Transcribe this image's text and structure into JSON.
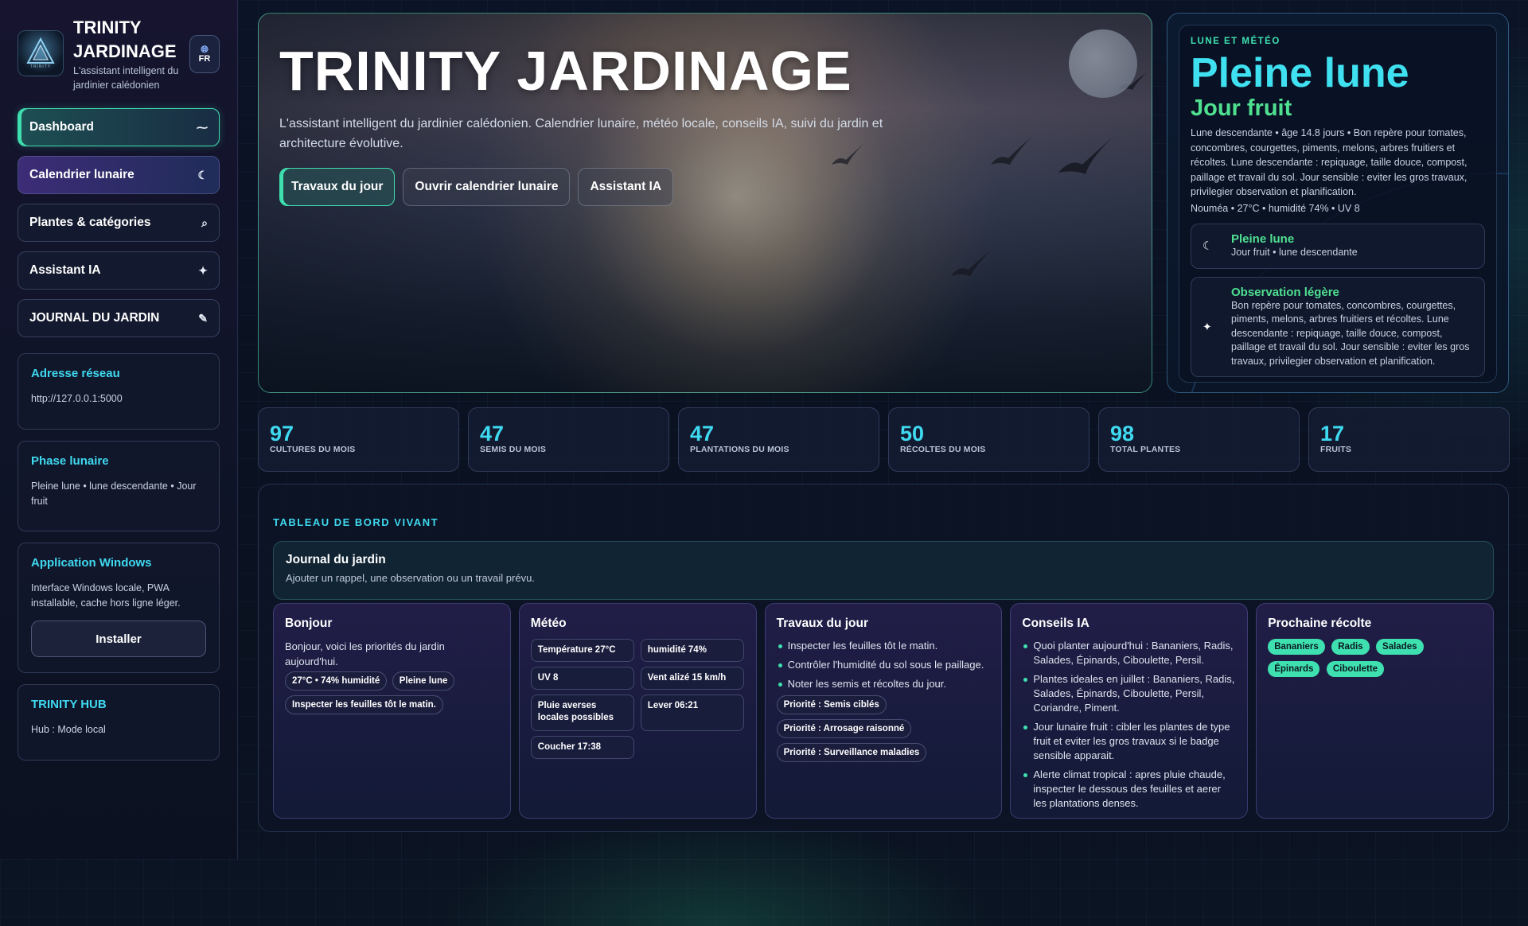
{
  "brand": {
    "title_line1": "TRINITY",
    "title_line2": "JARDINAGE",
    "subtitle": "L'assistant intelligent du jardinier calédonien",
    "logo_text": "TRINITY",
    "lang": "FR"
  },
  "nav": [
    {
      "label": "Dashboard",
      "icon": "pulse-icon"
    },
    {
      "label": "Calendrier lunaire",
      "icon": "moon-icon"
    },
    {
      "label": "Plantes & catégories",
      "icon": "search-icon"
    },
    {
      "label": "Assistant IA",
      "icon": "sparkle-icon"
    },
    {
      "label": "JOURNAL DU JARDIN",
      "icon": "pencil-icon"
    }
  ],
  "side_cards": {
    "network": {
      "title": "Adresse réseau",
      "text": "http://127.0.0.1:5000"
    },
    "phase": {
      "title": "Phase lunaire",
      "text": "Pleine lune • lune descendante • Jour fruit"
    },
    "windows": {
      "title": "Application Windows",
      "text": "Interface Windows locale, PWA installable, cache hors ligne léger.",
      "button": "Installer"
    },
    "hub": {
      "title": "TRINITY HUB",
      "text": "Hub : Mode local"
    }
  },
  "hero": {
    "title": "TRINITY JARDINAGE",
    "description": "L'assistant intelligent du jardinier calédonien. Calendrier lunaire, météo locale, conseils IA, suivi du jardin et architecture évolutive.",
    "buttons": [
      "Travaux du jour",
      "Ouvrir calendrier lunaire",
      "Assistant IA"
    ]
  },
  "moon_panel": {
    "eyebrow": "LUNE ET MÉTÉO",
    "phase": "Pleine lune",
    "day_type": "Jour fruit",
    "description": "Lune descendante • âge 14.8 jours • Bon repère pour tomates, concombres, courgettes, piments, melons, arbres fruitiers et récoltes. Lune descendante : repiquage, taille douce, compost, paillage et travail du sol. Jour sensible : eviter les gros travaux, privilegier observation et planification.",
    "weather_line": "Nouméa • 27°C • humidité 74% • UV 8",
    "card1_title": "Pleine lune",
    "card1_text": "Jour fruit • lune descendante",
    "card2_title": "Observation légère",
    "card2_text": "Bon repère pour tomates, concombres, courgettes, piments, melons, arbres fruitiers et récoltes. Lune descendante : repiquage, taille douce, compost, paillage et travail du sol. Jour sensible : eviter les gros travaux, privilegier observation et planification."
  },
  "stats": [
    {
      "value": "97",
      "label": "CULTURES DU MOIS"
    },
    {
      "value": "47",
      "label": "SEMIS DU MOIS"
    },
    {
      "value": "47",
      "label": "PLANTATIONS DU MOIS"
    },
    {
      "value": "50",
      "label": "RÉCOLTES DU MOIS"
    },
    {
      "value": "98",
      "label": "TOTAL PLANTES"
    },
    {
      "value": "17",
      "label": "FRUITS"
    }
  ],
  "dashboard": {
    "title": "TABLEAU DE BORD VIVANT",
    "journal_title": "Journal du jardin",
    "journal_text": "Ajouter un rappel, une observation ou un travail prévu.",
    "hello": {
      "title": "Bonjour",
      "text": "Bonjour, voici les priorités du jardin aujourd'hui.",
      "pills": [
        "27°C • 74% humidité",
        "Pleine lune",
        "Inspecter les feuilles tôt le matin."
      ]
    },
    "weather": {
      "title": "Météo",
      "boxes": [
        "Température 27°C",
        "humidité 74%",
        "UV 8",
        "Vent alizé 15 km/h",
        "Pluie averses locales possibles",
        "Lever 06:21",
        "Coucher 17:38"
      ]
    },
    "tasks": {
      "title": "Travaux du jour",
      "items": [
        "Inspecter les feuilles tôt le matin.",
        "Contrôler l'humidité du sol sous le paillage.",
        "Noter les semis et récoltes du jour."
      ],
      "pills": [
        "Priorité : Semis ciblés",
        "Priorité : Arrosage raisonné",
        "Priorité : Surveillance maladies"
      ]
    },
    "ai": {
      "title": "Conseils IA",
      "items": [
        "Quoi planter aujourd'hui : Bananiers, Radis, Salades, Épinards, Ciboulette, Persil.",
        "Plantes ideales en juillet : Bananiers, Radis, Salades, Épinards, Ciboulette, Persil, Coriandre, Piment.",
        "Jour lunaire fruit : cibler les plantes de type fruit et eviter les gros travaux si le badge sensible apparait.",
        "Alerte climat tropical : apres pluie chaude, inspecter le dessous des feuilles et aerer les plantations denses."
      ]
    },
    "harvest": {
      "title": "Prochaine récolte",
      "tags": [
        "Bananiers",
        "Radis",
        "Salades",
        "Épinards",
        "Ciboulette"
      ]
    }
  },
  "colors": {
    "accent_teal": "#3fe0b0",
    "accent_cyan": "#3fd9f0",
    "accent_green": "#4fe090"
  }
}
